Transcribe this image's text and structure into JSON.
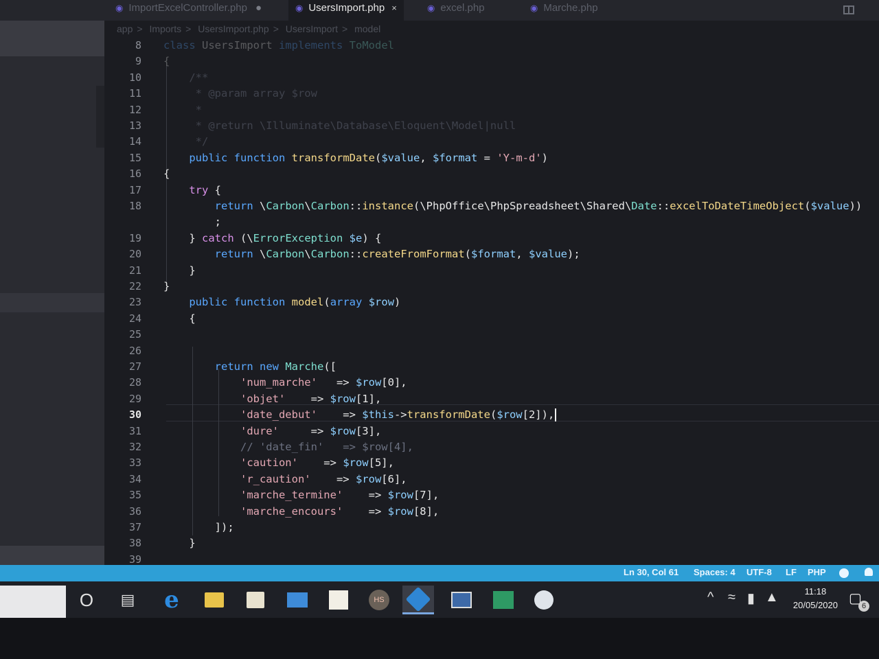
{
  "tabs": [
    {
      "label": "ImportExcelController.php",
      "active": false
    },
    {
      "label": "UsersImport.php",
      "active": true
    },
    {
      "label": "excel.php",
      "active": false
    },
    {
      "label": "Marche.php",
      "active": false
    }
  ],
  "tab_close_glyph": "×",
  "tab_modified_glyph": "●",
  "breadcrumb": [
    "app",
    "Imports",
    "UsersImport.php",
    "UsersImport",
    "model"
  ],
  "editor": {
    "current_line": "30",
    "lines": [
      {
        "n": "8",
        "code": "class UsersImport implements ToModel"
      },
      {
        "n": "9",
        "code": "{"
      },
      {
        "n": "10",
        "code": "    /**"
      },
      {
        "n": "11",
        "code": "     * @param array $row"
      },
      {
        "n": "12",
        "code": "     *"
      },
      {
        "n": "13",
        "code": "     * @return \\Illuminate\\Database\\Eloquent\\Model|null"
      },
      {
        "n": "14",
        "code": "     */"
      },
      {
        "n": "15",
        "code": "    public function transformDate($value, $format = 'Y-m-d')"
      },
      {
        "n": "16",
        "code": "{"
      },
      {
        "n": "17",
        "code": "    try {"
      },
      {
        "n": "18",
        "code": "        return \\Carbon\\Carbon::instance(\\PhpOffice\\PhpSpreadsheet\\Shared\\Date::excelToDateTimeObject($value))"
      },
      {
        "n": "",
        "code": "        ;"
      },
      {
        "n": "19",
        "code": "    } catch (\\ErrorException $e) {"
      },
      {
        "n": "20",
        "code": "        return \\Carbon\\Carbon::createFromFormat($format, $value);"
      },
      {
        "n": "21",
        "code": "    }"
      },
      {
        "n": "22",
        "code": "}"
      },
      {
        "n": "23",
        "code": "    public function model(array $row)"
      },
      {
        "n": "24",
        "code": "    {"
      },
      {
        "n": "25",
        "code": ""
      },
      {
        "n": "26",
        "code": ""
      },
      {
        "n": "27",
        "code": "        return new Marche(["
      },
      {
        "n": "28",
        "code": "            'num_marche'   => $row[0],"
      },
      {
        "n": "29",
        "code": "            'objet'    => $row[1],"
      },
      {
        "n": "30",
        "code": "            'date_debut'    => $this->transformDate($row[2]),"
      },
      {
        "n": "31",
        "code": "            'dure'     => $row[3],"
      },
      {
        "n": "32",
        "code": "            // 'date_fin'   => $row[4],"
      },
      {
        "n": "33",
        "code": "            'caution'    => $row[5],"
      },
      {
        "n": "34",
        "code": "            'r_caution'    => $row[6],"
      },
      {
        "n": "35",
        "code": "            'marche_termine'    => $row[7],"
      },
      {
        "n": "36",
        "code": "            'marche_encours'    => $row[8],"
      },
      {
        "n": "37",
        "code": "        ]);"
      },
      {
        "n": "38",
        "code": "    }"
      },
      {
        "n": "39",
        "code": ""
      }
    ]
  },
  "statusbar": {
    "position": "Ln 30, Col 61",
    "spaces": "Spaces: 4",
    "encoding": "UTF-8",
    "eol": "LF",
    "language": "PHP",
    "color": "#2e9fd6"
  },
  "taskbar": {
    "cortana_glyph": "O",
    "hs_label": "HS",
    "time": "11:18",
    "date": "20/05/2020",
    "notification_count": "6",
    "tray_chevron": "^"
  },
  "icons": [
    "cortana-icon",
    "task-view-icon",
    "edge-icon",
    "file-explorer-icon",
    "store-icon",
    "mail-icon",
    "notepad-icon",
    "hs-app-icon",
    "vscode-icon",
    "photos-icon",
    "excel-icon",
    "browser-icon",
    "wifi-icon",
    "battery-icon",
    "volume-icon",
    "notification-icon"
  ]
}
